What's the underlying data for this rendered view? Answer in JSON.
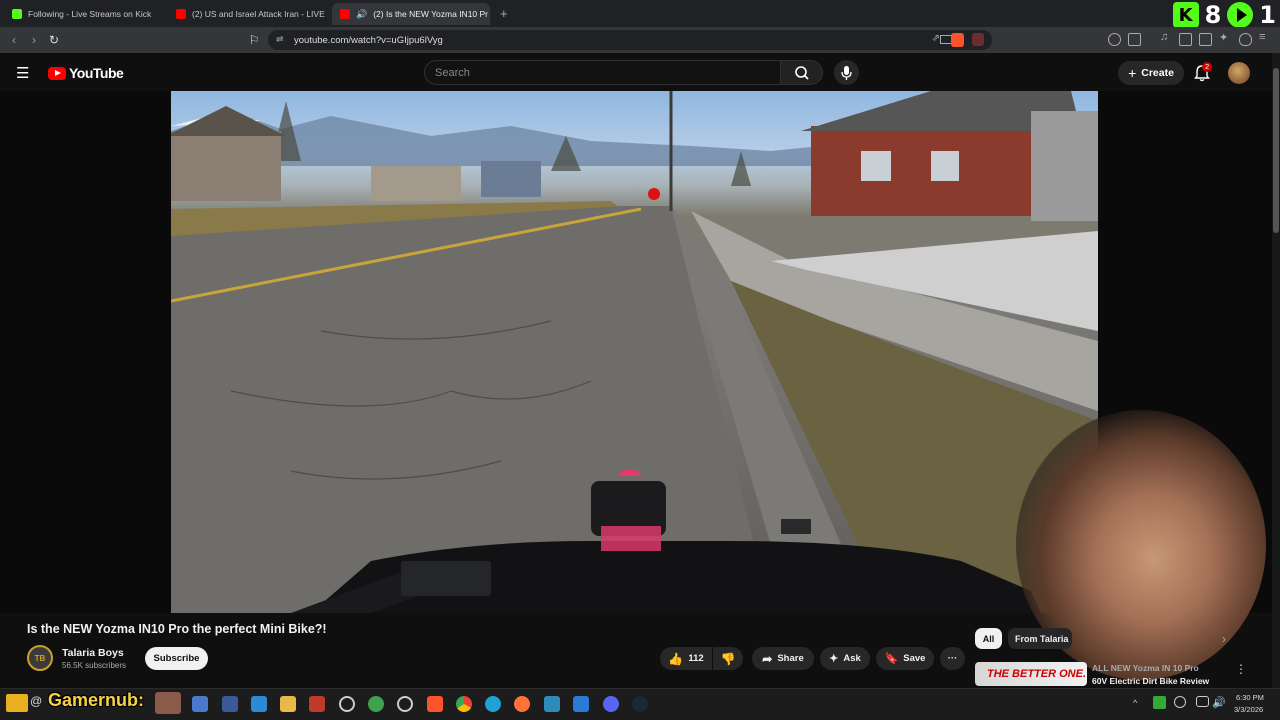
{
  "browser": {
    "tabs": [
      {
        "title": "Following - Live Streams on Kick",
        "favicon_color": "#53fc18"
      },
      {
        "title": "(2) US and Israel Attack Iran - LIVE Br",
        "favicon_color": "#ff0000"
      },
      {
        "title": "(2) Is the NEW Yozma IN10 Pr",
        "favicon_color": "#ff0000"
      }
    ],
    "url": "youtube.com/watch?v=uGIjpu6lVyg",
    "overlay_numbers": [
      "8",
      "1"
    ]
  },
  "youtube": {
    "logo_text": "YouTube",
    "search_placeholder": "Search",
    "create_label": "Create",
    "notification_count": "2"
  },
  "video": {
    "title": "Is the NEW Yozma IN10 Pro the perfect Mini Bike?!",
    "channel": {
      "name": "Talaria Boys",
      "subscribers": "56.5K subscribers",
      "avatar_text": "TB"
    },
    "subscribe_label": "Subscribe",
    "like_count": "112",
    "actions": {
      "share": "Share",
      "ask": "Ask",
      "save": "Save",
      "more": "···"
    }
  },
  "sidebar": {
    "chips": [
      {
        "label": "All"
      },
      {
        "label": "From Talaria"
      }
    ],
    "recommendation": {
      "thumb_text": "THE BETTER ONE.",
      "title_line1": "ALL NEW Yozma IN 10 Pro",
      "title_line2": "60V Electric Dirt Bike Review"
    }
  },
  "taskbar": {
    "streamer_name": "Gamernub:",
    "time": "6:30 PM",
    "date": "3/3/2026"
  },
  "colors": {
    "yt_red": "#ff0000",
    "kick_green": "#53fc18",
    "accent_yellow": "#f6d343"
  }
}
